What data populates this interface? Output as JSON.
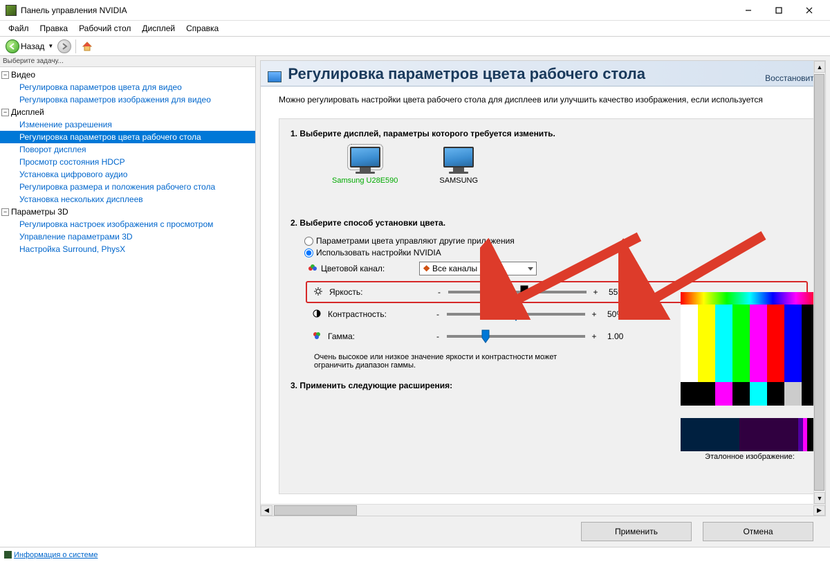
{
  "titlebar": {
    "title": "Панель управления NVIDIA"
  },
  "menu": {
    "file": "Файл",
    "edit": "Правка",
    "desktop": "Рабочий стол",
    "display": "Дисплей",
    "help": "Справка"
  },
  "toolbar": {
    "back": "Назад"
  },
  "sidebar": {
    "header": "Выберите задачу...",
    "groups": [
      {
        "label": "Видео",
        "items": [
          "Регулировка параметров цвета для видео",
          "Регулировка параметров изображения для видео"
        ]
      },
      {
        "label": "Дисплей",
        "items": [
          "Изменение разрешения",
          "Регулировка параметров цвета рабочего стола",
          "Поворот дисплея",
          "Просмотр состояния HDCP",
          "Установка цифрового аудио",
          "Регулировка размера и положения рабочего стола",
          "Установка нескольких дисплеев"
        ],
        "selected": 1
      },
      {
        "label": "Параметры 3D",
        "items": [
          "Регулировка настроек изображения с просмотром",
          "Управление параметрами 3D",
          "Настройка Surround, PhysX"
        ]
      }
    ]
  },
  "page": {
    "title": "Регулировка параметров цвета рабочего стола",
    "restore": "Восстановить",
    "intro": "Можно регулировать настройки цвета рабочего стола для дисплеев или улучшить качество изображения, если используется",
    "step1": "1. Выберите дисплей, параметры которого требуется изменить.",
    "displays": [
      {
        "name": "Samsung U28E590",
        "selected": true
      },
      {
        "name": "SAMSUNG",
        "selected": false
      }
    ],
    "step2": "2. Выберите способ установки цвета.",
    "radio1": "Параметрами цвета управляют другие приложения",
    "radio2": "Использовать настройки NVIDIA",
    "channelLabel": "Цветовой канал:",
    "channelValue": "Все каналы",
    "sliders": {
      "brightness": {
        "label": "Яркость:",
        "value": "55%",
        "pos": 55
      },
      "contrast": {
        "label": "Контрастность:",
        "value": "50%",
        "pos": 50
      },
      "gamma": {
        "label": "Гамма:",
        "value": "1.00",
        "pos": 28
      }
    },
    "note": "Очень высокое или низкое значение яркости и контрастности может ограничить диапазон гаммы.",
    "step3": "3. Применить следующие расширения:",
    "refCaption": "Эталонное изображение:"
  },
  "buttons": {
    "apply": "Применить",
    "cancel": "Отмена"
  },
  "statusbar": {
    "sysinfo": "Информация о системе"
  }
}
